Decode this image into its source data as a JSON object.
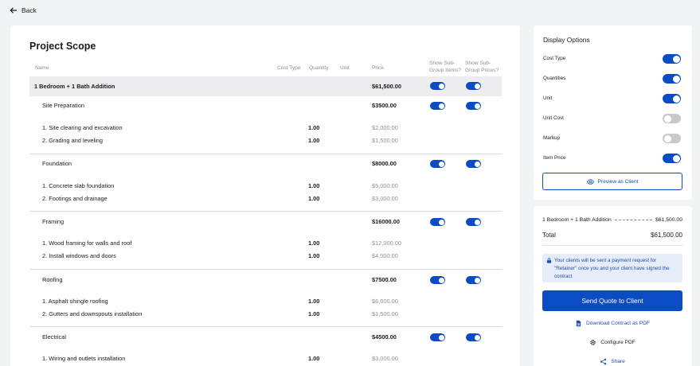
{
  "nav": {
    "back_label": "Back"
  },
  "scope": {
    "title": "Project Scope",
    "columns": {
      "name": "Name",
      "cost_type": "Cost Type",
      "quantity": "Quantity",
      "unit": "Unit",
      "price": "Price",
      "show_items": "Show Sub-Group Items?",
      "show_prices": "Show Sub-Group Prices?"
    },
    "group": {
      "name": "1 Bedroom + 1 Bath Addition",
      "price": "$61,500.00",
      "show_items": true,
      "show_prices": true
    },
    "subgroups": [
      {
        "name": "Site Preparation",
        "price": "$3500.00",
        "show_items": true,
        "show_prices": true,
        "items": [
          {
            "name": "1.  Site clearing and excavation",
            "qty": "1.00",
            "price": "$2,000.00"
          },
          {
            "name": "2.  Grading and leveling",
            "qty": "1.00",
            "price": "$1,500.00"
          }
        ]
      },
      {
        "name": "Foundation",
        "price": "$8000.00",
        "show_items": true,
        "show_prices": true,
        "items": [
          {
            "name": "1.  Concrete slab foundation",
            "qty": "1.00",
            "price": "$5,000.00"
          },
          {
            "name": "2.  Footings and drainage",
            "qty": "1.00",
            "price": "$3,000.00"
          }
        ]
      },
      {
        "name": "Framing",
        "price": "$16000.00",
        "show_items": true,
        "show_prices": true,
        "items": [
          {
            "name": "1.  Wood framing for walls and roof",
            "qty": "1.00",
            "price": "$12,000.00"
          },
          {
            "name": "2.  Install windows and doors",
            "qty": "1.00",
            "price": "$4,000.00"
          }
        ]
      },
      {
        "name": "Roofing",
        "price": "$7500.00",
        "show_items": true,
        "show_prices": true,
        "items": [
          {
            "name": "1.  Asphalt shingle roofing",
            "qty": "1.00",
            "price": "$6,000.00"
          },
          {
            "name": "2.  Gutters and downspouts installation",
            "qty": "1.00",
            "price": "$1,500.00"
          }
        ]
      },
      {
        "name": "Electrical",
        "price": "$4500.00",
        "show_items": true,
        "show_prices": true,
        "items": [
          {
            "name": "1.  Wiring and outlets installation",
            "qty": "1.00",
            "price": "$3,000.00"
          }
        ]
      }
    ]
  },
  "display_options": {
    "title": "Display Options",
    "options": [
      {
        "label": "Cost Type",
        "on": true
      },
      {
        "label": "Quantities",
        "on": true
      },
      {
        "label": "Unit",
        "on": true
      },
      {
        "label": "Unit Cost",
        "on": false
      },
      {
        "label": "Markup",
        "on": false
      },
      {
        "label": "Item Price",
        "on": true
      }
    ],
    "preview_label": "Preview as Client"
  },
  "summary": {
    "line_name": "1 Bedroom + 1 Bath Addition",
    "line_amount": "$61,500.00",
    "total_label": "Total",
    "total_amount": "$61,500.00",
    "info_text": "Your clients will be sent a payment request for \"Retainer\" once you and your client have signed the contract",
    "send_label": "Send Quote to Client",
    "download_label": "Download Contract as PDF",
    "configure_label": "Configure PDF",
    "share_label": "Share"
  },
  "colors": {
    "accent": "#0b4cc4",
    "info_bg": "#e6edf9",
    "background": "#f2f3f5"
  }
}
